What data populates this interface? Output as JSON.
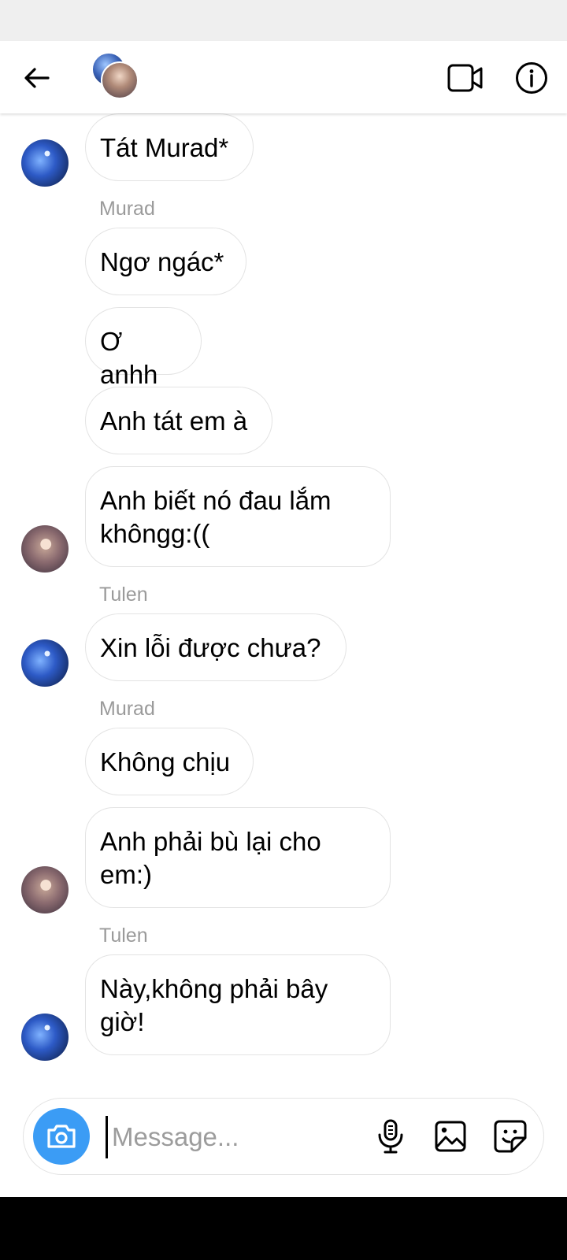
{
  "header": {
    "back": "back-arrow-icon",
    "group_avatar": "group-avatar",
    "video_call": "video-camera-icon",
    "info": "info-icon"
  },
  "messages": [
    {
      "type": "bubble",
      "text": "Tát Murad*",
      "avatar": "blue"
    },
    {
      "type": "sender",
      "text": "Murad"
    },
    {
      "type": "bubble",
      "text": "Ngơ ngác*"
    },
    {
      "type": "bubble",
      "text": "Ơ anhh"
    },
    {
      "type": "bubble",
      "text": "Anh tát em à"
    },
    {
      "type": "bubble",
      "text": "Anh biết nó đau lắm\nkhôngg:((",
      "avatar": "pink"
    },
    {
      "type": "sender",
      "text": "Tulen"
    },
    {
      "type": "bubble",
      "text": "Xin lỗi được chưa?",
      "avatar": "blue"
    },
    {
      "type": "sender",
      "text": "Murad"
    },
    {
      "type": "bubble",
      "text": "Không chịu"
    },
    {
      "type": "bubble",
      "text": "Anh phải bù lại cho\nem:)",
      "avatar": "pink"
    },
    {
      "type": "sender",
      "text": "Tulen"
    },
    {
      "type": "bubble",
      "text": "Này,không phải bây\ngiờ!",
      "avatar": "blue"
    }
  ],
  "composer": {
    "placeholder": "Message...",
    "camera_icon": "camera-icon",
    "mic_icon": "microphone-icon",
    "gallery_icon": "gallery-icon",
    "sticker_icon": "sticker-icon",
    "accent_color": "#3b9cf5"
  }
}
